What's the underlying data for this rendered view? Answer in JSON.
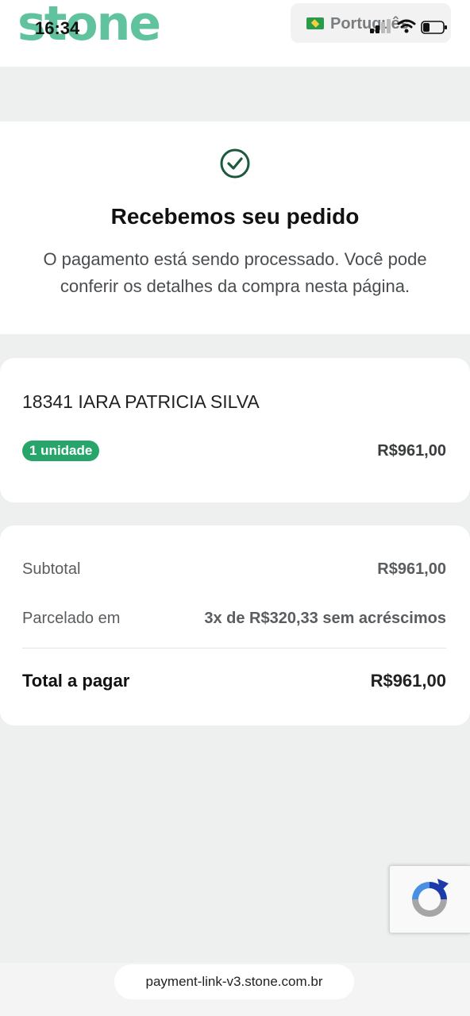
{
  "status_bar": {
    "time": "16:34"
  },
  "header": {
    "logo_text": "stone",
    "language": {
      "label": "Português",
      "flag_icon": "brazil-flag-icon"
    }
  },
  "confirmation": {
    "icon": "check-circle-icon",
    "title": "Recebemos seu pedido",
    "message": "O pagamento está sendo processado. Você pode conferir os detalhes da compra nesta página."
  },
  "order_item": {
    "name": "18341 IARA PATRICIA SILVA",
    "quantity_badge": "1 unidade",
    "price": "R$961,00"
  },
  "summary": {
    "subtotal_label": "Subtotal",
    "subtotal_value": "R$961,00",
    "installments_label": "Parcelado em",
    "installments_value": "3x de R$320,33 sem acréscimos",
    "total_label": "Total a pagar",
    "total_value": "R$961,00"
  },
  "browser": {
    "url": "payment-link-v3.stone.com.br"
  },
  "colors": {
    "brand_green": "#2bb07d",
    "badge_green": "#28a56a",
    "check_dark_green": "#1d5a3d",
    "page_bg": "#eeefef"
  }
}
